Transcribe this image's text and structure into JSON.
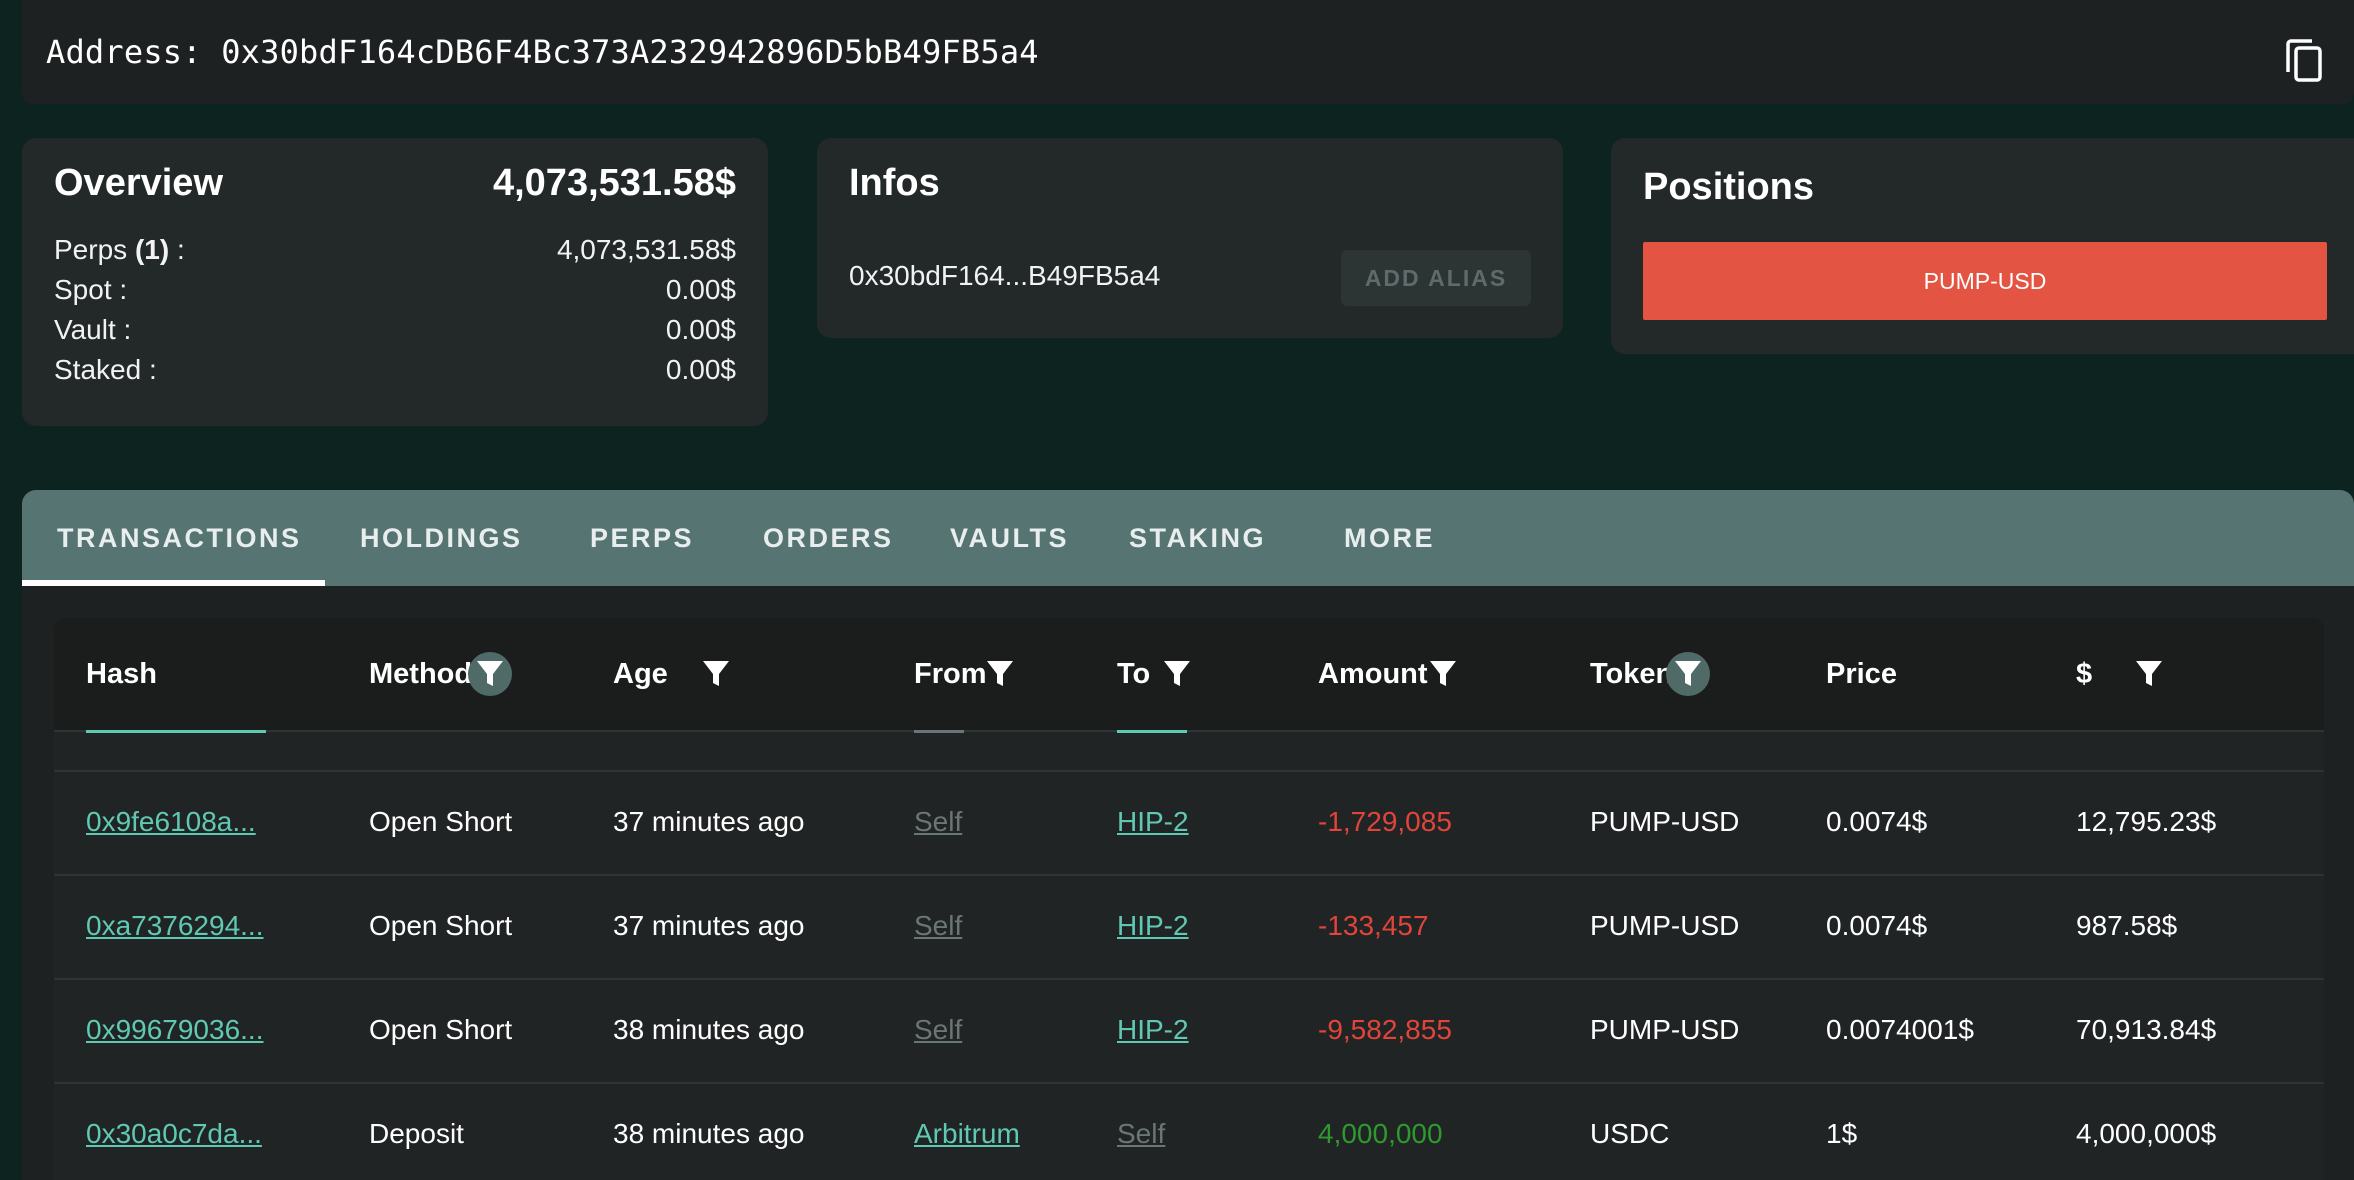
{
  "address": {
    "text": "Address: 0x30bdF164cDB6F4Bc373A232942896D5bB49FB5a4"
  },
  "overview": {
    "title": "Overview",
    "total": "4,073,531.58$",
    "rows": [
      {
        "label_prefix": "Perps ",
        "label_bold": "(1)",
        "label_suffix": " :",
        "value": "4,073,531.58$"
      },
      {
        "label": "Spot :",
        "value": "0.00$"
      },
      {
        "label": "Vault :",
        "value": "0.00$"
      },
      {
        "label": "Staked :",
        "value": "0.00$"
      }
    ]
  },
  "infos": {
    "title": "Infos",
    "short_address": "0x30bdF164...B49FB5a4",
    "add_alias_label": "ADD ALIAS"
  },
  "positions": {
    "title": "Positions",
    "items": [
      {
        "label": "PUMP-USD",
        "color": "#e45442"
      }
    ]
  },
  "tabs": [
    {
      "label": "TRANSACTIONS",
      "active": true
    },
    {
      "label": "HOLDINGS"
    },
    {
      "label": "PERPS"
    },
    {
      "label": "ORDERS"
    },
    {
      "label": "VAULTS"
    },
    {
      "label": "STAKING"
    },
    {
      "label": "MORE"
    }
  ],
  "table": {
    "columns": [
      {
        "label": "Hash"
      },
      {
        "label": "Method",
        "filter": "active"
      },
      {
        "label": "Age",
        "filter": "plain"
      },
      {
        "label": "From",
        "filter": "plain"
      },
      {
        "label": "To",
        "filter": "plain"
      },
      {
        "label": "Amount",
        "filter": "plain"
      },
      {
        "label": "Token",
        "filter": "active"
      },
      {
        "label": "Price"
      },
      {
        "label": "$",
        "filter": "plain"
      }
    ],
    "rows": [
      {
        "hash": "0x9fe6108a...",
        "method": "Open Short",
        "age": "37 minutes ago",
        "from": "Self",
        "to": "HIP-2",
        "amount": "-1,729,085",
        "token": "PUMP-USD",
        "price": "0.0074$",
        "usd": "12,795.23$"
      },
      {
        "hash": "0xa7376294...",
        "method": "Open Short",
        "age": "37 minutes ago",
        "from": "Self",
        "to": "HIP-2",
        "amount": "-133,457",
        "token": "PUMP-USD",
        "price": "0.0074$",
        "usd": "987.58$"
      },
      {
        "hash": "0x99679036...",
        "method": "Open Short",
        "age": "38 minutes ago",
        "from": "Self",
        "to": "HIP-2",
        "amount": "-9,582,855",
        "token": "PUMP-USD",
        "price": "0.0074001$",
        "usd": "70,913.84$"
      },
      {
        "hash": "0x30a0c7da...",
        "method": "Deposit",
        "age": "38 minutes ago",
        "from": "Arbitrum",
        "to": "Self",
        "amount": "4,000,000",
        "token": "USDC",
        "price": "1$",
        "usd": "4,000,000$"
      }
    ]
  },
  "colors": {
    "background": "#0d2320",
    "card": "#232828",
    "tab_bar": "#567471",
    "link": "#5fc9b4",
    "negative": "#e0443a",
    "positive": "#2e9a2e"
  }
}
